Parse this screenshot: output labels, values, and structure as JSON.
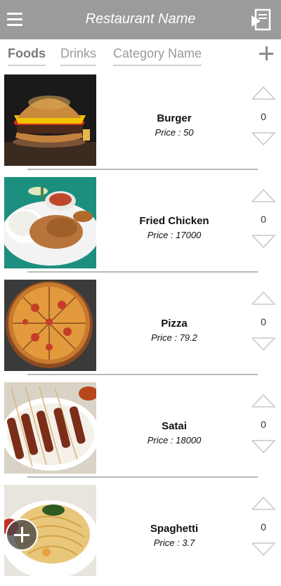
{
  "header": {
    "title": "Restaurant Name",
    "menu_icon": "hamburger-menu-icon",
    "exit_icon": "exit-door-icon"
  },
  "tabs": [
    {
      "label": "Foods",
      "active": true
    },
    {
      "label": "Drinks",
      "active": false
    },
    {
      "label": "Category Name",
      "active": false
    }
  ],
  "items": [
    {
      "name": "Burger",
      "price_label": "Price :  50",
      "quantity": "0",
      "image": "burger-photo"
    },
    {
      "name": "Fried Chicken",
      "price_label": "Price :  17000",
      "quantity": "0",
      "image": "fried-chicken-photo"
    },
    {
      "name": "Pizza",
      "price_label": "Price :  79.2",
      "quantity": "0",
      "image": "pizza-photo"
    },
    {
      "name": "Satai",
      "price_label": "Price :  18000",
      "quantity": "0",
      "image": "satai-photo"
    },
    {
      "name": "Spaghetti",
      "price_label": "Price :  3.7",
      "quantity": "0",
      "image": "spaghetti-photo"
    }
  ],
  "colors": {
    "header_bg": "#9b9b9b",
    "divider": "#b9b9b9",
    "arrow": "#c8c8c8"
  }
}
